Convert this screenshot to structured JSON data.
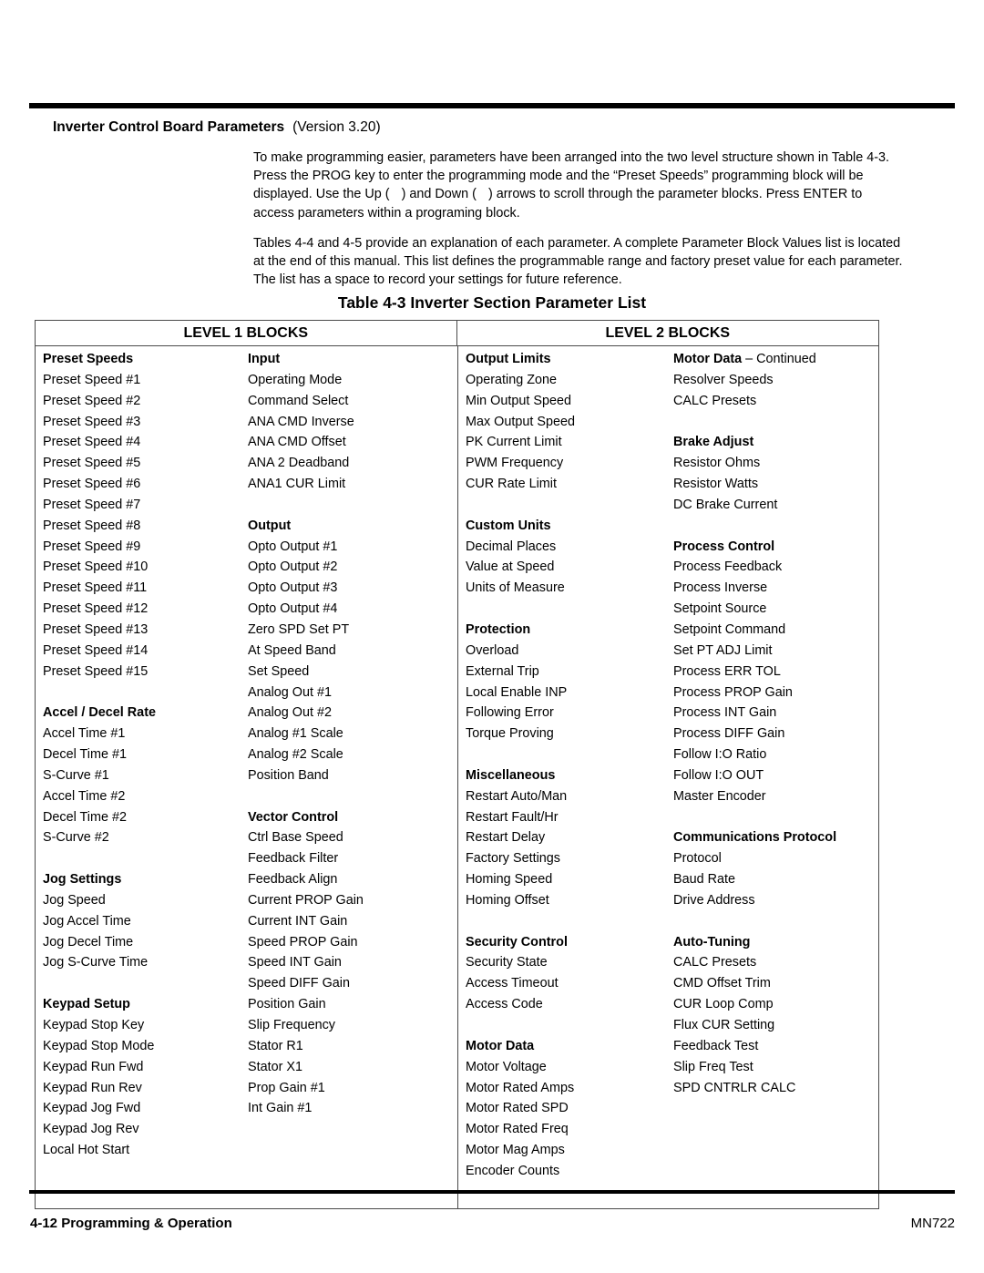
{
  "heading": {
    "title": "Inverter Control Board Parameters",
    "version": "(Version 3.20)"
  },
  "paragraphs": {
    "p1_a": "To make programming easier, parameters have been arranged into the two level structure shown in Table 4-3.  Press the PROG key to enter the programming mode and the “Preset Speeds” programming block will be displayed.  Use the Up (",
    "p1_b": ") and Down (",
    "p1_c": ") arrows to scroll through the parameter blocks.  Press ENTER to access parameters within a programing block.",
    "p2": "Tables 4-4 and 4-5 provide an explanation of each parameter.  A complete Parameter Block Values list is located at the end of this manual. This list defines the programmable range and factory preset value for each parameter.  The list has a space to record your settings for future reference."
  },
  "table": {
    "caption": "Table 4-3  Inverter Section Parameter List",
    "level1_header": "LEVEL 1 BLOCKS",
    "level2_header": "LEVEL 2 BLOCKS",
    "col1": [
      {
        "text": "Preset Speeds",
        "bold": true
      },
      {
        "text": "Preset Speed #1"
      },
      {
        "text": "Preset Speed #2"
      },
      {
        "text": "Preset Speed #3"
      },
      {
        "text": "Preset Speed #4"
      },
      {
        "text": "Preset Speed #5"
      },
      {
        "text": "Preset Speed #6"
      },
      {
        "text": "Preset Speed #7"
      },
      {
        "text": "Preset Speed #8"
      },
      {
        "text": "Preset Speed #9"
      },
      {
        "text": "Preset Speed #10"
      },
      {
        "text": "Preset Speed #11"
      },
      {
        "text": "Preset Speed #12"
      },
      {
        "text": "Preset Speed #13"
      },
      {
        "text": "Preset Speed #14"
      },
      {
        "text": "Preset Speed #15"
      },
      {
        "text": ""
      },
      {
        "text": "Accel / Decel Rate",
        "bold": true
      },
      {
        "text": "Accel Time #1"
      },
      {
        "text": "Decel Time #1"
      },
      {
        "text": "S-Curve #1"
      },
      {
        "text": "Accel Time #2"
      },
      {
        "text": "Decel Time #2"
      },
      {
        "text": "S-Curve #2"
      },
      {
        "text": ""
      },
      {
        "text": "Jog Settings",
        "bold": true
      },
      {
        "text": "Jog Speed"
      },
      {
        "text": "Jog Accel Time"
      },
      {
        "text": "Jog Decel Time"
      },
      {
        "text": "Jog S-Curve Time"
      },
      {
        "text": ""
      },
      {
        "text": "Keypad Setup",
        "bold": true
      },
      {
        "text": "Keypad Stop Key"
      },
      {
        "text": "Keypad Stop Mode"
      },
      {
        "text": "Keypad Run Fwd"
      },
      {
        "text": "Keypad Run Rev"
      },
      {
        "text": "Keypad Jog Fwd"
      },
      {
        "text": "Keypad Jog Rev"
      },
      {
        "text": "Local Hot Start"
      },
      {
        "text": ""
      },
      {
        "text": ""
      }
    ],
    "col2": [
      {
        "text": "Input",
        "bold": true
      },
      {
        "text": "Operating Mode"
      },
      {
        "text": "Command Select"
      },
      {
        "text": "ANA CMD Inverse"
      },
      {
        "text": "ANA CMD Offset"
      },
      {
        "text": "ANA 2 Deadband"
      },
      {
        "text": "ANA1 CUR Limit"
      },
      {
        "text": ""
      },
      {
        "text": "Output",
        "bold": true
      },
      {
        "text": "Opto Output #1"
      },
      {
        "text": "Opto Output #2"
      },
      {
        "text": "Opto Output #3"
      },
      {
        "text": "Opto Output #4"
      },
      {
        "text": "Zero SPD Set PT"
      },
      {
        "text": "At Speed Band"
      },
      {
        "text": "Set Speed"
      },
      {
        "text": "Analog Out #1"
      },
      {
        "text": "Analog Out #2"
      },
      {
        "text": "Analog #1 Scale"
      },
      {
        "text": "Analog #2 Scale"
      },
      {
        "text": "Position Band"
      },
      {
        "text": ""
      },
      {
        "text": "Vector Control",
        "bold": true
      },
      {
        "text": "Ctrl Base Speed"
      },
      {
        "text": "Feedback Filter"
      },
      {
        "text": "Feedback Align"
      },
      {
        "text": "Current PROP Gain"
      },
      {
        "text": "Current INT Gain"
      },
      {
        "text": "Speed PROP Gain"
      },
      {
        "text": "Speed INT Gain"
      },
      {
        "text": "Speed DIFF Gain"
      },
      {
        "text": "Position Gain"
      },
      {
        "text": "Slip Frequency"
      },
      {
        "text": "Stator R1"
      },
      {
        "text": "Stator X1"
      },
      {
        "text": "Prop Gain #1"
      },
      {
        "text": "Int Gain #1"
      },
      {
        "text": ""
      },
      {
        "text": ""
      },
      {
        "text": ""
      },
      {
        "text": ""
      }
    ],
    "col3": [
      {
        "text": "Output Limits",
        "bold": true
      },
      {
        "text": "Operating Zone"
      },
      {
        "text": "Min Output Speed"
      },
      {
        "text": "Max Output Speed"
      },
      {
        "text": "PK Current Limit"
      },
      {
        "text": "PWM Frequency"
      },
      {
        "text": "CUR Rate Limit"
      },
      {
        "text": ""
      },
      {
        "text": "Custom Units",
        "bold": true
      },
      {
        "text": "Decimal Places"
      },
      {
        "text": "Value at Speed"
      },
      {
        "text": "Units of Measure"
      },
      {
        "text": ""
      },
      {
        "text": "Protection",
        "bold": true
      },
      {
        "text": "Overload"
      },
      {
        "text": "External Trip"
      },
      {
        "text": "Local Enable INP"
      },
      {
        "text": "Following Error"
      },
      {
        "text": "Torque Proving"
      },
      {
        "text": ""
      },
      {
        "text": "Miscellaneous",
        "bold": true
      },
      {
        "text": "Restart Auto/Man"
      },
      {
        "text": "Restart Fault/Hr"
      },
      {
        "text": "Restart Delay"
      },
      {
        "text": "Factory Settings"
      },
      {
        "text": "Homing Speed"
      },
      {
        "text": "Homing Offset"
      },
      {
        "text": ""
      },
      {
        "text": "Security Control",
        "bold": true
      },
      {
        "text": "Security State"
      },
      {
        "text": "Access Timeout"
      },
      {
        "text": "Access Code"
      },
      {
        "text": ""
      },
      {
        "text": "Motor Data",
        "bold": true
      },
      {
        "text": "Motor Voltage"
      },
      {
        "text": "Motor Rated Amps"
      },
      {
        "text": "Motor Rated SPD"
      },
      {
        "text": "Motor Rated Freq"
      },
      {
        "text": "Motor Mag Amps"
      },
      {
        "text": "Encoder Counts"
      },
      {
        "text": ""
      }
    ],
    "col4": [
      {
        "text": "Motor Data",
        "bold": true,
        "cont": " – Continued"
      },
      {
        "text": "Resolver Speeds"
      },
      {
        "text": "CALC Presets"
      },
      {
        "text": ""
      },
      {
        "text": "Brake Adjust",
        "bold": true
      },
      {
        "text": "Resistor Ohms"
      },
      {
        "text": "Resistor Watts"
      },
      {
        "text": "DC Brake Current"
      },
      {
        "text": ""
      },
      {
        "text": "Process Control",
        "bold": true
      },
      {
        "text": "Process Feedback"
      },
      {
        "text": "Process Inverse"
      },
      {
        "text": "Setpoint Source"
      },
      {
        "text": "Setpoint Command"
      },
      {
        "text": "Set PT ADJ Limit"
      },
      {
        "text": "Process ERR TOL"
      },
      {
        "text": "Process PROP Gain"
      },
      {
        "text": "Process INT Gain"
      },
      {
        "text": "Process DIFF Gain"
      },
      {
        "text": "Follow I:O Ratio"
      },
      {
        "text": "Follow I:O OUT"
      },
      {
        "text": "Master Encoder"
      },
      {
        "text": ""
      },
      {
        "text": "Communications Protocol",
        "bold": true
      },
      {
        "text": "Protocol"
      },
      {
        "text": "Baud Rate"
      },
      {
        "text": "Drive Address"
      },
      {
        "text": ""
      },
      {
        "text": "Auto-Tuning",
        "bold": true
      },
      {
        "text": "CALC Presets"
      },
      {
        "text": "CMD Offset Trim"
      },
      {
        "text": "CUR Loop Comp"
      },
      {
        "text": "Flux CUR Setting"
      },
      {
        "text": "Feedback Test"
      },
      {
        "text": "Slip Freq Test"
      },
      {
        "text": "SPD CNTRLR CALC"
      },
      {
        "text": ""
      },
      {
        "text": ""
      },
      {
        "text": ""
      },
      {
        "text": ""
      },
      {
        "text": ""
      }
    ]
  },
  "footer": {
    "page_number": "4-12",
    "section": "Programming & Operation",
    "manual_code": "MN722"
  }
}
